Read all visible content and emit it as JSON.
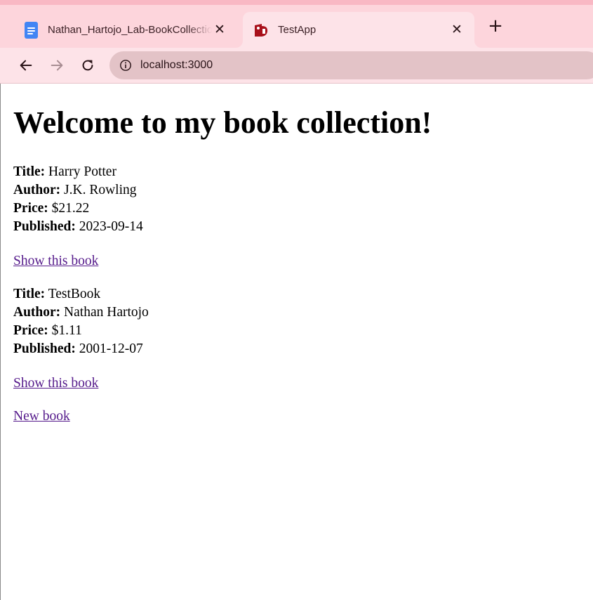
{
  "browser": {
    "tabs": [
      {
        "title": "Nathan_Hartojo_Lab-BookCollection",
        "icon": "google-docs-icon",
        "active": false
      },
      {
        "title": "TestApp",
        "icon": "rails-icon",
        "active": true
      }
    ],
    "new_tab_label": "+",
    "close_glyph": "✕",
    "address": "localhost:3000"
  },
  "page": {
    "heading": "Welcome to my book collection!",
    "field_labels": {
      "title": "Title:",
      "author": "Author:",
      "price": "Price:",
      "published": "Published:"
    },
    "books": [
      {
        "title": "Harry Potter",
        "author": "J.K. Rowling",
        "price": "$21.22",
        "published": "2023-09-14",
        "link": "Show this book"
      },
      {
        "title": "TestBook",
        "author": "Nathan Hartojo",
        "price": "$1.11",
        "published": "2001-12-07",
        "link": "Show this book"
      }
    ],
    "new_book_link": "New book"
  },
  "colors": {
    "tabstrip": "#fdd5dc",
    "active_tab": "#fde3e8",
    "omnibox": "#e3c3c7",
    "docs_blue": "#4285f4",
    "rails_red": "#a8101a",
    "visited_link": "#551a8b"
  }
}
